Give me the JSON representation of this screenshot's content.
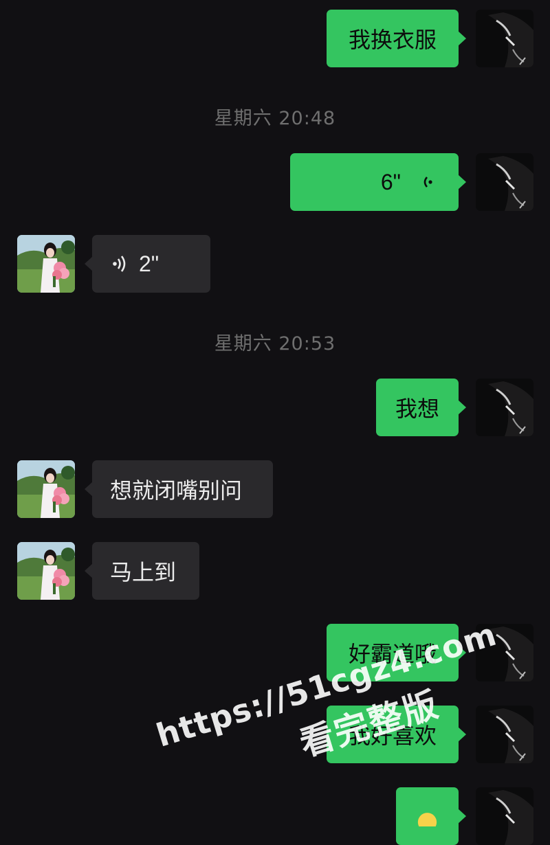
{
  "conversation": {
    "messages": [
      {
        "kind": "text",
        "side": "out",
        "text": "我换衣服"
      },
      {
        "kind": "timestamp",
        "text": "星期六 20:48"
      },
      {
        "kind": "voice",
        "side": "out",
        "duration": "6\""
      },
      {
        "kind": "voice",
        "side": "in",
        "duration": "2\""
      },
      {
        "kind": "timestamp",
        "text": "星期六 20:53"
      },
      {
        "kind": "text",
        "side": "out",
        "text": "我想"
      },
      {
        "kind": "text",
        "side": "in",
        "text": "想就闭嘴别问"
      },
      {
        "kind": "text",
        "side": "in",
        "text": "马上到"
      },
      {
        "kind": "text",
        "side": "out",
        "text": "好霸道哦"
      },
      {
        "kind": "text",
        "side": "out",
        "text": "我好喜欢"
      }
    ]
  },
  "avatars": {
    "me": "dark-portrait",
    "her": "girl-with-flowers-outdoors"
  },
  "watermark": {
    "url": "https://51cgz4.com",
    "caption": "看完整版"
  },
  "colors": {
    "background": "#111013",
    "outgoing_bubble": "#34c560",
    "incoming_bubble": "#2a292c",
    "timestamp_text": "#6f6f6f"
  }
}
